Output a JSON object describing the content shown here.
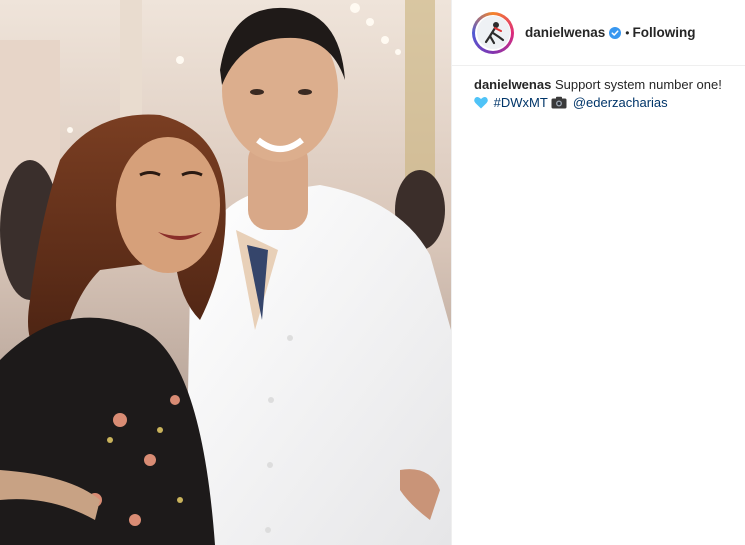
{
  "post": {
    "username": "danielwenas",
    "verified": true,
    "separator": "•",
    "follow_status": "Following",
    "caption": {
      "username": "danielwenas",
      "text": "Support system number one!",
      "heart_emoji": "light-blue-heart-icon",
      "hashtag": "#DWxMT",
      "camera_emoji": "camera-icon",
      "mention": "@ederzacharias"
    }
  },
  "colors": {
    "link": "#003569",
    "verified_badge": "#3897f0",
    "heart": "#4fc3f7"
  }
}
